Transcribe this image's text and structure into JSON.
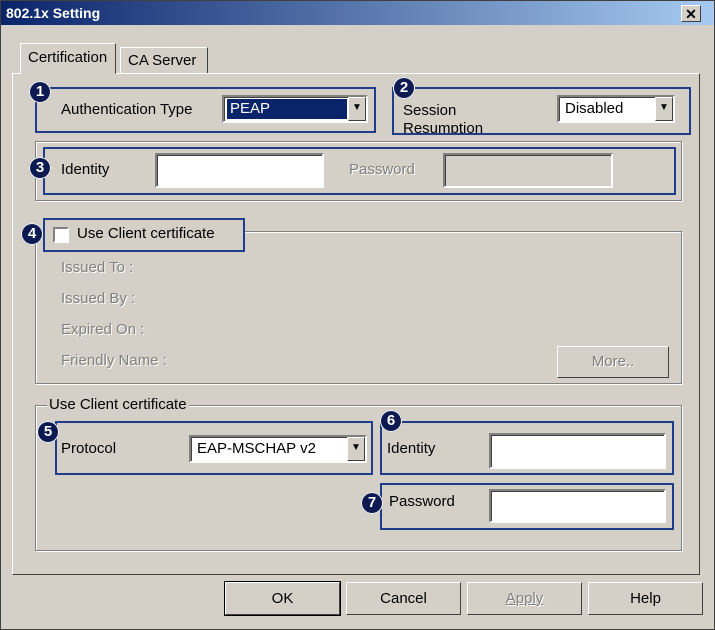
{
  "window": {
    "title": "802.1x Setting",
    "close_glyph": "✕"
  },
  "tabs": [
    {
      "label": "Certification"
    },
    {
      "label": "CA Server"
    }
  ],
  "badges": [
    "1",
    "2",
    "3",
    "4",
    "5",
    "6",
    "7"
  ],
  "auth": {
    "label": "Authentication Type",
    "value": "PEAP"
  },
  "session": {
    "label": "Session Resumption",
    "value": "Disabled"
  },
  "identity_row": {
    "identity_label": "Identity",
    "identity_value": "",
    "password_label": "Password",
    "password_value": ""
  },
  "client_cert": {
    "checkbox_label": "Use Client certificate",
    "checked": false,
    "issued_to": "Issued To :",
    "issued_by": "Issued By :",
    "expired_on": "Expired On :",
    "friendly_name": "Friendly Name :",
    "more_label": "More.."
  },
  "inner": {
    "group_label": "Use Client certificate",
    "protocol_label": "Protocol",
    "protocol_value": "EAP-MSCHAP v2",
    "identity_label": "Identity",
    "identity_value": "",
    "password_label": "Password",
    "password_value": ""
  },
  "buttons": {
    "ok": "OK",
    "cancel": "Cancel",
    "apply": "Apply",
    "help": "Help"
  },
  "colors": {
    "face": "#d4d0c8",
    "highlight_border": "#1f3d8a",
    "badge": "#0d1b52",
    "title_start": "#0a246a"
  },
  "icons": {
    "dropdown": "chevron-down-icon",
    "close": "close-icon"
  }
}
